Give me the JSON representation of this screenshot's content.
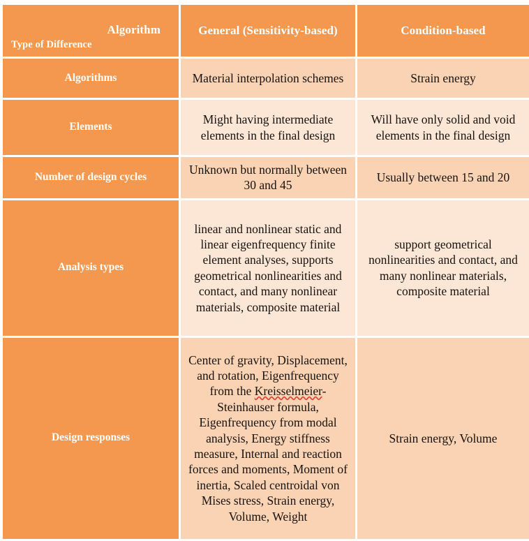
{
  "table": {
    "corner": {
      "top_label": "Algorithm",
      "bottom_label": "Type of Difference"
    },
    "columns": [
      {
        "key": "general",
        "label": "General (Sensitivity-based)"
      },
      {
        "key": "condition",
        "label": "Condition-based"
      }
    ],
    "rows": [
      {
        "label": "Algorithms",
        "general": "Material interpolation schemes",
        "condition": "Strain energy"
      },
      {
        "label": "Elements",
        "general": "Might having intermediate elements in the final design",
        "condition": "Will have only solid and void elements in the final design"
      },
      {
        "label": "Number of design cycles",
        "general": "Unknown but normally between 30 and 45",
        "condition": "Usually between 15 and 20"
      },
      {
        "label": "Analysis types",
        "general": "linear and nonlinear static and linear eigenfrequency finite element analyses, supports geometrical nonlinearities and contact, and many nonlinear materials, composite material",
        "condition": "support geometrical nonlinearities and contact, and many nonlinear materials, composite material"
      },
      {
        "label": "Design responses",
        "general_part1": "Center of gravity, Displacement, and rotation, Eigenfrequency from the ",
        "general_misspelled": "Kreisselmeier",
        "general_part2": "-Steinhauser formula, Eigenfrequency from modal analysis, Energy stiffness measure, Internal and reaction forces and moments, Moment of inertia, Scaled centroidal von Mises stress, Strain energy, Volume, Weight",
        "condition": "Strain energy, Volume"
      }
    ],
    "colors": {
      "header_orange": "#F3984E",
      "row_shade_dark": "#FAD3B4",
      "row_shade_light": "#FCE7D7",
      "header_text": "#FFFFFF",
      "body_text": "#18120D",
      "spellcheck_underline": "#D8453B"
    }
  }
}
